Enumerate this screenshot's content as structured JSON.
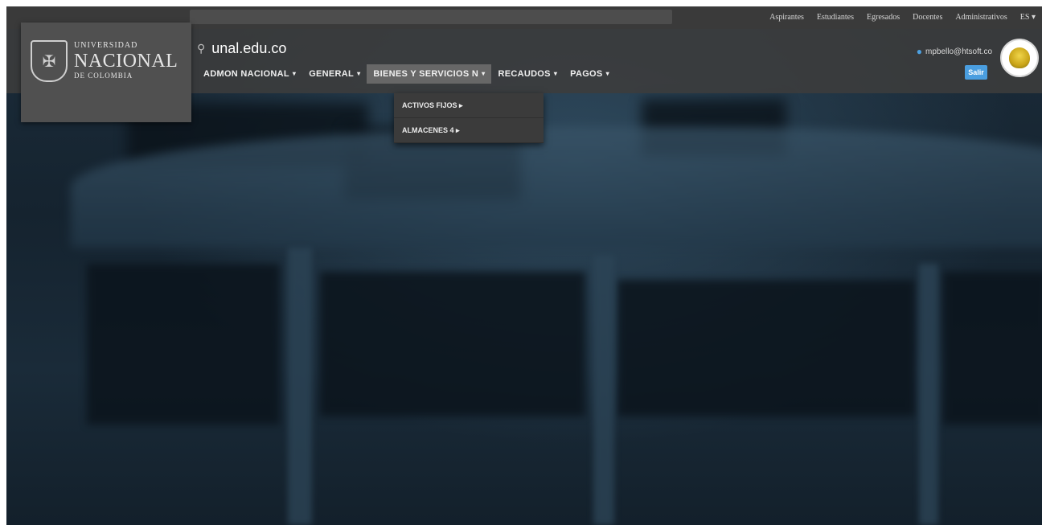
{
  "topnav": {
    "links": [
      "Aspirantes",
      "Estudiantes",
      "Egresados",
      "Docentes",
      "Administrativos"
    ],
    "language": "ES",
    "language_caret": "▾"
  },
  "logo": {
    "line1": "UNIVERSIDAD",
    "line2": "NACIONAL",
    "line3": "DE COLOMBIA"
  },
  "site": {
    "domain": "unal.edu.co"
  },
  "mainnav": {
    "items": [
      {
        "label": "ADMON NACIONAL",
        "caret": "▾"
      },
      {
        "label": "GENERAL",
        "caret": "▾"
      },
      {
        "label": "BIENES Y SERVICIOS N",
        "caret": "▾"
      },
      {
        "label": "RECAUDOS",
        "caret": "▾"
      },
      {
        "label": "PAGOS",
        "caret": "▾"
      }
    ],
    "active_index": 2
  },
  "dropdown": {
    "items": [
      "ACTIVOS FIJOS ▸",
      "ALMACENES 4 ▸"
    ]
  },
  "user": {
    "email": "mpbello@htsoft.co",
    "logout_label": "Salir"
  },
  "colors": {
    "accent": "#4a9ee0",
    "header_bg": "#3c3c3c"
  }
}
